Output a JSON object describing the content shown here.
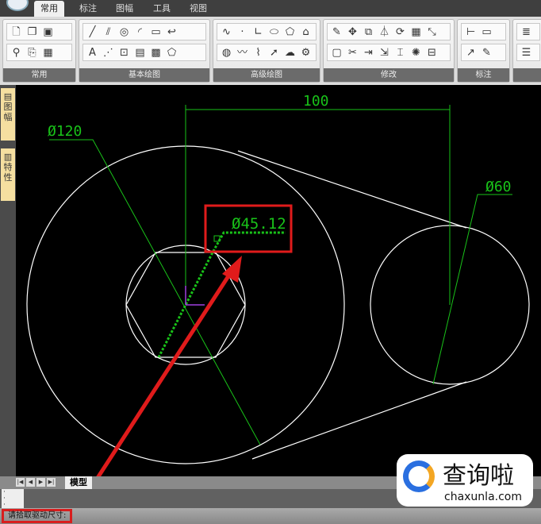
{
  "tabs": [
    {
      "label": "常用",
      "active": true
    },
    {
      "label": "标注"
    },
    {
      "label": "图幅"
    },
    {
      "label": "工具"
    },
    {
      "label": "视图"
    }
  ],
  "panels": [
    {
      "label": "常用",
      "row1": [
        "new-file-icon",
        "copy-icon",
        "calculator-icon"
      ],
      "row2": [
        "zoom-icon",
        "paste-icon",
        "properties-icon"
      ]
    },
    {
      "label": "基本绘图",
      "row1": [
        "line-icon",
        "parallel-icon",
        "circle-icon",
        "arc-icon",
        "rectangle-icon",
        "polyline-icon"
      ],
      "row2": [
        "text-icon",
        "centerline-icon",
        "block-icon",
        "table-icon",
        "hatch-icon",
        "region-icon"
      ]
    },
    {
      "label": "高级绘图",
      "row1": [
        "spline-icon",
        "dot-icon",
        "angle-icon",
        "ellipse-icon",
        "polygon-icon",
        "image-icon"
      ],
      "row2": [
        "hole-icon",
        "wave-icon",
        "break-icon",
        "arrow-icon",
        "cloud-icon",
        "gear-icon"
      ]
    },
    {
      "label": "修改",
      "row1": [
        "erase-icon",
        "move-icon",
        "copy-object-icon",
        "mirror-icon",
        "rotate-icon",
        "array-icon",
        "scale-icon"
      ],
      "row2": [
        "offset-icon",
        "trim-icon",
        "extend-icon",
        "stretch-icon",
        "break-at-icon",
        "explode-icon",
        "align-icon"
      ]
    },
    {
      "label": "标注",
      "row1": [
        "dimension-icon",
        "dim-style-icon"
      ],
      "row2": [
        "leader-icon",
        "edit-dim-icon"
      ]
    },
    {
      "label": "",
      "row1": [
        "layer-icon"
      ],
      "row2": [
        "lineweight-icon"
      ]
    }
  ],
  "sidebar": [
    "图幅",
    "特性"
  ],
  "drawing": {
    "dim_distance": "100",
    "dim_big_circle": "Ø120",
    "dim_small_circle": "Ø60",
    "dim_hole": "Ø45.12",
    "line_color": "#ffffff",
    "dim_color": "#19c219",
    "highlight_color": "#e01b1b"
  },
  "layout_tab": "模型",
  "command_prompt": "请拾取驱动尺寸:",
  "watermark": {
    "cn": "查询啦",
    "en": "chaxunla.com"
  }
}
